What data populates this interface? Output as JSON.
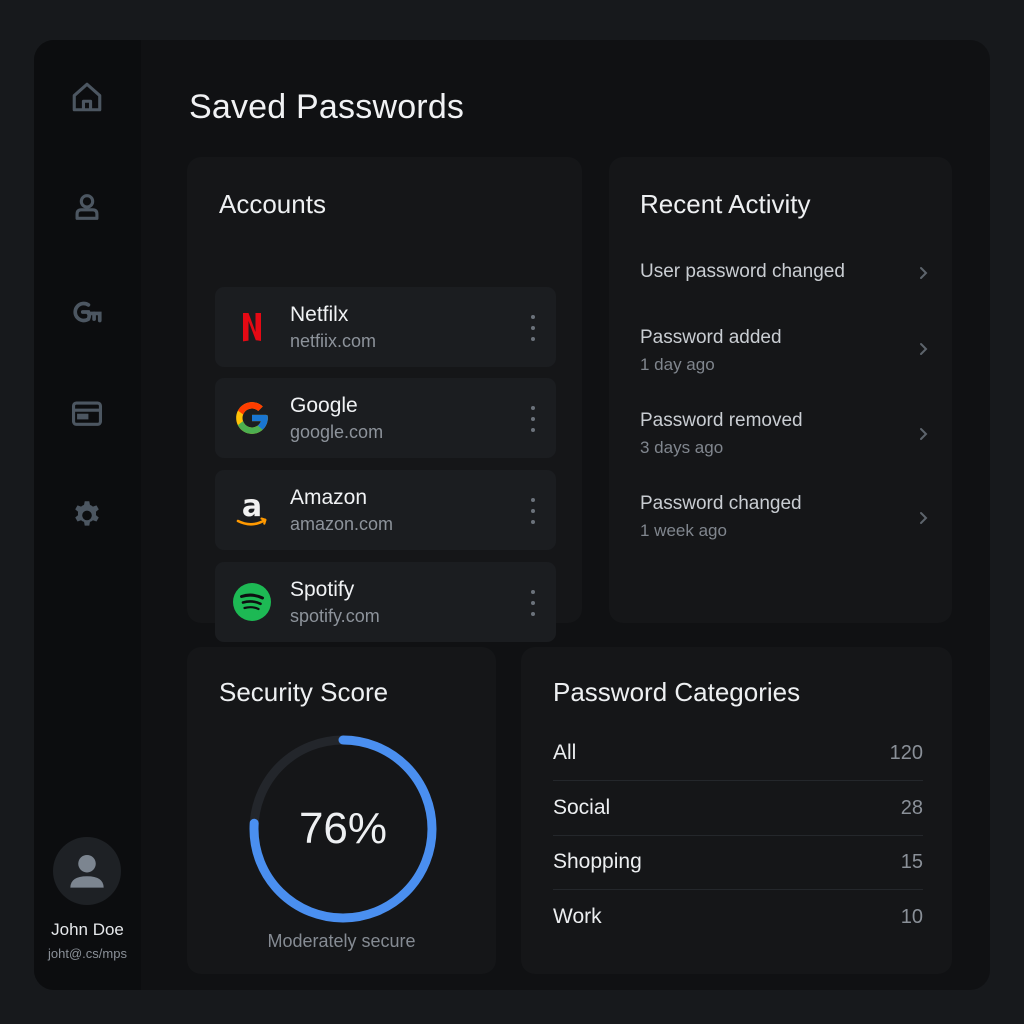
{
  "page": {
    "title": "Saved Passwords"
  },
  "sidebar": {
    "items": [
      {
        "icon": "home-icon"
      },
      {
        "icon": "user-icon"
      },
      {
        "icon": "key-icon"
      },
      {
        "icon": "wallet-icon"
      },
      {
        "icon": "gear-icon"
      }
    ],
    "user": {
      "name": "John Doe",
      "email": "joht@.cs/mps"
    }
  },
  "accounts": {
    "title": "Accounts",
    "items": [
      {
        "name": "Netfilx",
        "domain": "netfiix.com",
        "icon": "netflix-logo",
        "color": "#e50914"
      },
      {
        "name": "Google",
        "domain": "google.com",
        "icon": "google-logo",
        "color": "#4285f4"
      },
      {
        "name": "Amazon",
        "domain": "amazon.com",
        "icon": "amazon-logo",
        "color": "#ff9900"
      },
      {
        "name": "Spotify",
        "domain": "spotify.com",
        "icon": "spotify-logo",
        "color": "#1db954"
      }
    ]
  },
  "activity": {
    "title": "Recent Activity",
    "items": [
      {
        "title": "User password changed",
        "time": ""
      },
      {
        "title": "Password added",
        "time": "1 day ago"
      },
      {
        "title": "Password removed",
        "time": "3 days ago"
      },
      {
        "title": "Password changed",
        "time": "1 week ago"
      }
    ]
  },
  "security": {
    "title": "Security Score",
    "value": "76%",
    "score_fraction": 0.76,
    "caption": "Moderately secure",
    "accent": "#4a8ff0"
  },
  "categories": {
    "title": "Password Categories",
    "items": [
      {
        "label": "All",
        "count": "120"
      },
      {
        "label": "Social",
        "count": "28"
      },
      {
        "label": "Shopping",
        "count": "15"
      },
      {
        "label": "Work",
        "count": "10"
      }
    ]
  }
}
